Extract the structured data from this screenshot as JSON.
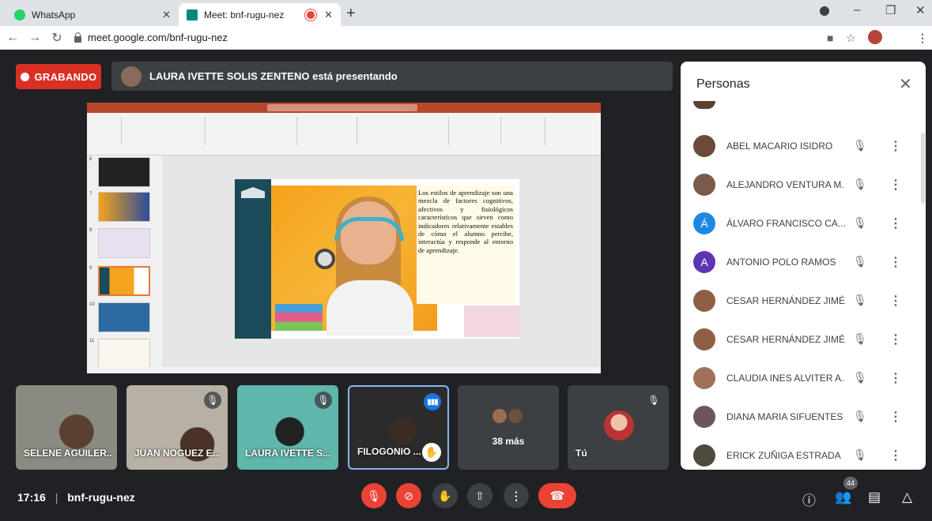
{
  "browser": {
    "tabs": [
      {
        "title": "WhatsApp",
        "active": false,
        "favicon_color": "#25d366"
      },
      {
        "title": "Meet: bnf-rugu-nez",
        "active": true,
        "favicon_color": "#00897b"
      }
    ],
    "new_tab": "+",
    "url": "meet.google.com/bnf-rugu-nez",
    "window_controls": [
      "–",
      "❐",
      "✕"
    ]
  },
  "meet": {
    "recording_label": "GRABANDO",
    "presenting_text": "LAURA IVETTE SOLIS ZENTENO está presentando",
    "slide_text": "Los estilos de aprendizaje son una mezcla de factores cognitivos, afectivos y fisiológicos característicos que sirven como indicadores relativamente estables de cómo el alumno percibe, interactúa y responde al entorno de aprendizaje.",
    "slide_numbers": [
      "6",
      "7",
      "8",
      "9",
      "10",
      "11"
    ],
    "tiles": [
      {
        "name": "SELENE AGUILER...",
        "muted": false
      },
      {
        "name": "JUAN NOGUEZ E...",
        "muted": true
      },
      {
        "name": "LAURA IVETTE S...",
        "muted": true
      },
      {
        "name": "FILOGONIO ...",
        "speaking": true,
        "hand_raised": true
      },
      {
        "name": "38 más"
      },
      {
        "name": "Tú",
        "muted": true
      }
    ],
    "meeting_code": "bnf-rugu-nez",
    "time": "17:16",
    "participant_count": "44"
  },
  "people": {
    "title": "Personas",
    "items": [
      {
        "name": "ABEL MACARIO ISIDRO",
        "avatar_color": "#6b4a3a",
        "initial": ""
      },
      {
        "name": "ALEJANDRO VENTURA M...",
        "avatar_color": "#7a5a48",
        "initial": ""
      },
      {
        "name": "ÁLVARO FRANCISCO CA...",
        "avatar_color": "#1e88e5",
        "initial": "Á"
      },
      {
        "name": "ANTONIO POLO RAMOS",
        "avatar_color": "#5e35b1",
        "initial": "A"
      },
      {
        "name": "CESAR HERNÁNDEZ JIMÉ...",
        "avatar_color": "#8d5f45",
        "initial": ""
      },
      {
        "name": "CESAR HERNÁNDEZ JIMÉ...",
        "avatar_color": "#8d5f45",
        "initial": ""
      },
      {
        "name": "CLAUDIA INES ALVITER A...",
        "avatar_color": "#a0705a",
        "initial": ""
      },
      {
        "name": "DIANA MARIA SIFUENTES ...",
        "avatar_color": "#6d5560",
        "initial": ""
      },
      {
        "name": "ERICK ZUÑIGA ESTRADA",
        "avatar_color": "#4e4a40",
        "initial": ""
      }
    ]
  },
  "colors": {
    "record_red": "#d93025",
    "accent_blue": "#1a73e8",
    "hangup_red": "#ea4335"
  }
}
